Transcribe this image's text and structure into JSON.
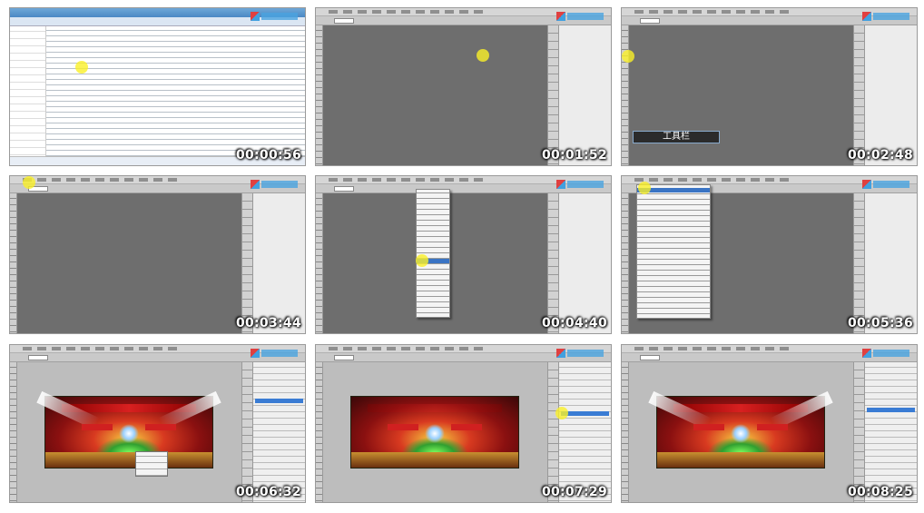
{
  "frames": [
    {
      "type": "explorer",
      "timestamp": "00:00:56"
    },
    {
      "type": "ps-empty",
      "timestamp": "00:01:52"
    },
    {
      "type": "ps-tool-label",
      "timestamp": "00:02:48",
      "label": "工具栏"
    },
    {
      "type": "ps-empty-highlight",
      "timestamp": "00:03:44"
    },
    {
      "type": "ps-menu",
      "timestamp": "00:04:40"
    },
    {
      "type": "ps-menu-wide",
      "timestamp": "00:05:36"
    },
    {
      "type": "ps-stage",
      "timestamp": "00:06:32"
    },
    {
      "type": "ps-stage",
      "timestamp": "00:07:29"
    },
    {
      "type": "ps-stage",
      "timestamp": "00:08:25"
    }
  ],
  "colors": {
    "cursor_highlight": "#faf028",
    "selection": "#3a74c4"
  }
}
